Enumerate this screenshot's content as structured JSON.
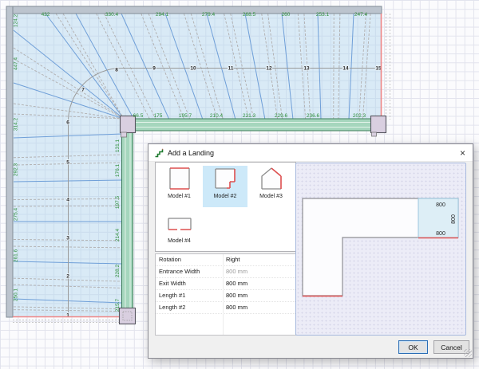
{
  "drawing": {
    "top_dims": [
      "432",
      "330.4",
      "294.1",
      "279.4",
      "268.5",
      "260",
      "253.1",
      "247.4"
    ],
    "left_dims": [
      "124.2",
      "447.4",
      "314.2",
      "292.3",
      "275.4",
      "261.6",
      "250.1"
    ],
    "rail_dims_horizontal": [
      "66.5",
      "175",
      "195.7",
      "210.4",
      "221.3",
      "229.6",
      "236.6",
      "202.3"
    ],
    "rail_dims_vertical": [
      "131.1",
      "176.1",
      "197.5",
      "214.4",
      "228.2",
      "215.7"
    ],
    "tread_numbers": [
      "1",
      "2",
      "3",
      "4",
      "5",
      "6",
      "7",
      "8",
      "9",
      "10",
      "11",
      "12",
      "13",
      "14",
      "15"
    ],
    "colors": {
      "dimension_text": "#2f8f3b",
      "tread_line": "#6f9fd8",
      "dashed_line": "#b0aeae",
      "walkline": "#9a9a9a",
      "boundary_red": "#ef8686",
      "rail_fill": "#a5d6bd",
      "rail_border": "#3f7e5c",
      "post_fill": "#d9cfe0",
      "wall_fill": "#bcc4ce",
      "stair_fill": "rgba(176,212,238,0.45)"
    }
  },
  "dialog": {
    "title": "Add a Landing",
    "close_icon": "×",
    "models": [
      {
        "label": "Model #1",
        "selected": false
      },
      {
        "label": "Model #2",
        "selected": true
      },
      {
        "label": "Model #3",
        "selected": false
      },
      {
        "label": "Model #4",
        "selected": false
      }
    ],
    "properties": [
      {
        "label": "Rotation",
        "value": "Right",
        "muted": false
      },
      {
        "label": "Entrance Width",
        "value": "800 mm",
        "muted": true
      },
      {
        "label": "Exit Width",
        "value": "800 mm",
        "muted": false
      },
      {
        "label": "Length #1",
        "value": "800 mm",
        "muted": false
      },
      {
        "label": "Length #2",
        "value": "800 mm",
        "muted": false
      }
    ],
    "preview": {
      "dim_top": "800",
      "dim_right": "800",
      "dim_bottom": "800"
    },
    "buttons": {
      "ok": "OK",
      "cancel": "Cancel"
    },
    "selection_color": "#cde9f9"
  }
}
